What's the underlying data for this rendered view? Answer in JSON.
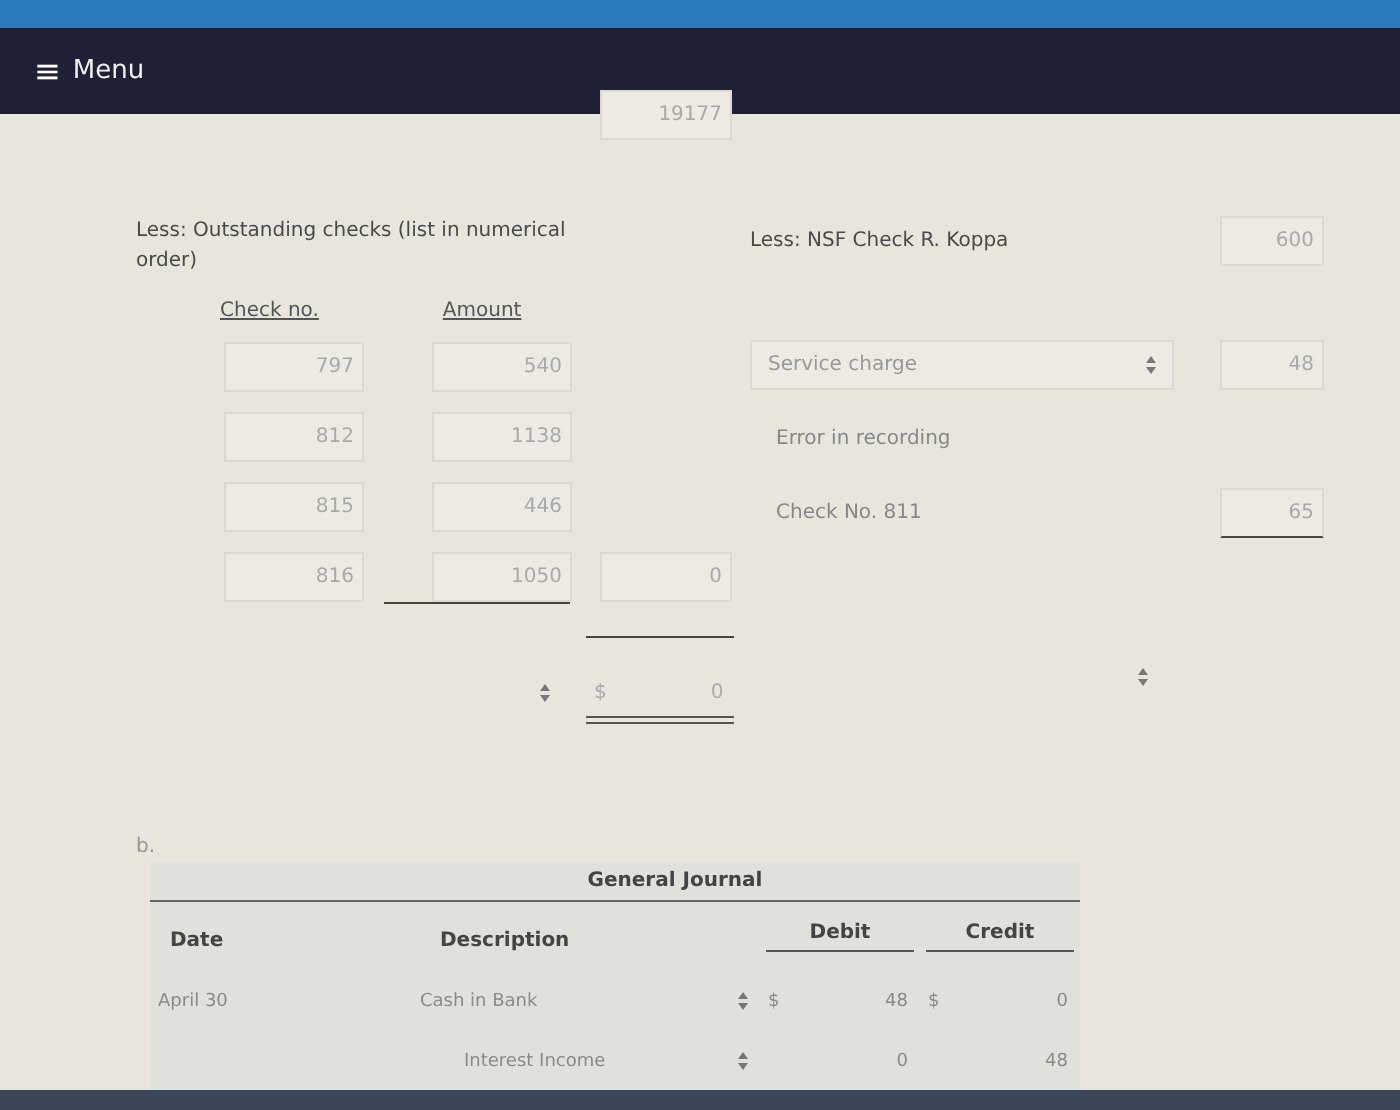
{
  "menu": {
    "icon": "≡",
    "label": "Menu"
  },
  "balance": {
    "value": "19177"
  },
  "outstanding": {
    "label": "Less: Outstanding checks (list in numerical order)",
    "columns": [
      "Check no.",
      "Amount"
    ],
    "rows": [
      {
        "check": "797",
        "amount": "540"
      },
      {
        "check": "812",
        "amount": "1138"
      },
      {
        "check": "815",
        "amount": "446"
      },
      {
        "check": "816",
        "amount": "1050",
        "subtotal": "0"
      }
    ],
    "total_prefix": "$",
    "total": "0"
  },
  "deductions": {
    "nsf_label": "Less: NSF Check R. Koppa",
    "nsf_value": "600",
    "items": [
      {
        "kind": "select",
        "label": "Service charge",
        "value": "48"
      },
      {
        "kind": "text",
        "label": "Error in recording"
      },
      {
        "kind": "text",
        "label": "Check No. 811",
        "value": "65"
      }
    ]
  },
  "journal": {
    "part": "b.",
    "title": "General Journal",
    "columns": [
      "Date",
      "Description",
      "Debit",
      "Credit"
    ],
    "rows": [
      {
        "month": "April",
        "day": "30",
        "account": "Cash in Bank",
        "debit_prefix": "$",
        "debit": "48",
        "credit_prefix": "$",
        "credit": "0"
      },
      {
        "account": "Interest Income",
        "debit": "0",
        "credit": "48"
      }
    ]
  }
}
